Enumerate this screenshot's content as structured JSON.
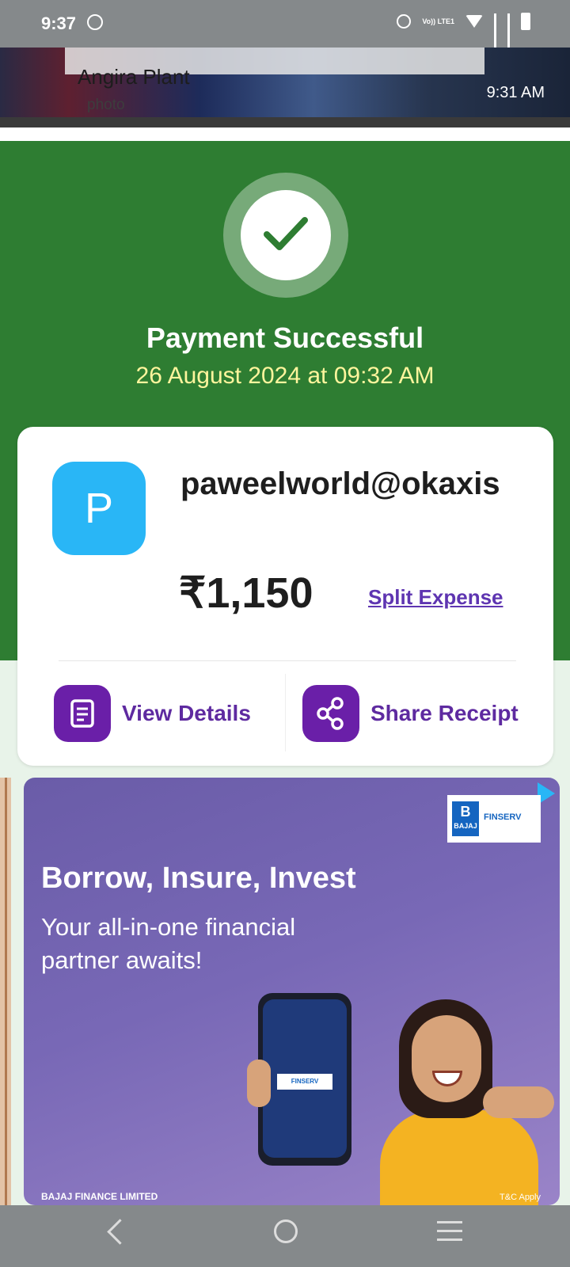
{
  "status_bar": {
    "time": "9:37",
    "icons": [
      "whatsapp-icon",
      "alarm-icon",
      "volte-icon",
      "wifi-icon",
      "signal-icon",
      "signal-icon",
      "battery-icon"
    ],
    "volte_text": "Vo)) LTE1"
  },
  "notification": {
    "title": "Angira Plant",
    "subtitle": "photo",
    "time": "9:31 AM"
  },
  "payment": {
    "status": "Payment Successful",
    "datetime": "26 August 2024 at 09:32 AM",
    "avatar_letter": "P",
    "payee_id": "paweelworld@okaxis",
    "amount": "₹1,150",
    "split_label": "Split Expense",
    "view_details_label": "View Details",
    "share_receipt_label": "Share Receipt"
  },
  "ad": {
    "brand": "FINSERV",
    "brand_mark": "B",
    "brand_small": "BAJAJ",
    "headline": "Borrow, Insure, Invest",
    "subline": "Your all-in-one financial partner awaits!",
    "footer_left": "BAJAJ FINANCE LIMITED",
    "footer_right": "T&C Apply"
  },
  "colors": {
    "green_header": "#2e7d32",
    "date_yellow": "#fff59d",
    "avatar_blue": "#29b6f6",
    "action_purple": "#6a1fa8",
    "link_purple": "#5e35b1"
  }
}
